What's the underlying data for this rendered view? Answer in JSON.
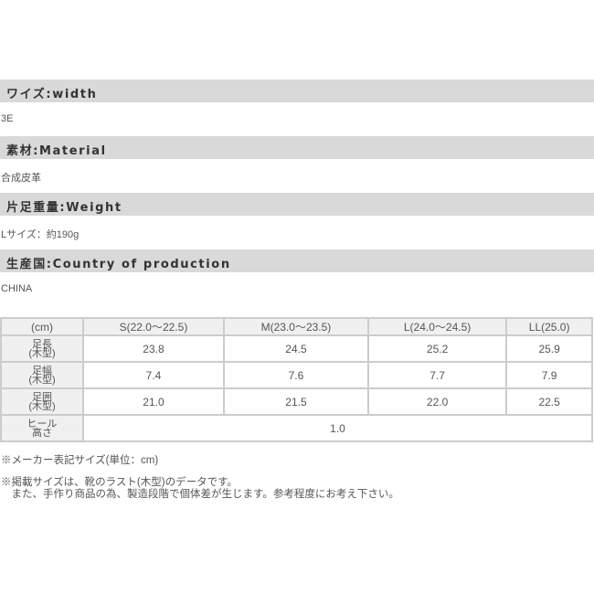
{
  "sections": [
    {
      "heading": "ワイズ:width",
      "value": "3E"
    },
    {
      "heading": "素材:Material",
      "value": "合成皮革"
    },
    {
      "heading": "片足重量:Weight",
      "value": "Lサイズ：約190g"
    },
    {
      "heading": "生産国:Country of production",
      "value": "CHINA"
    }
  ],
  "size_table": {
    "corner": "(cm)",
    "columns": [
      "S(22.0〜22.5)",
      "M(23.0〜23.5)",
      "L(24.0〜24.5)",
      "LL(25.0)"
    ],
    "rows": [
      {
        "label_line1": "足長",
        "label_line2": "(木型)",
        "values": [
          "23.8",
          "24.5",
          "25.2",
          "25.9"
        ]
      },
      {
        "label_line1": "足幅",
        "label_line2": "(木型)",
        "values": [
          "7.4",
          "7.6",
          "7.7",
          "7.9"
        ]
      },
      {
        "label_line1": "足囲",
        "label_line2": "(木型)",
        "values": [
          "21.0",
          "21.5",
          "22.0",
          "22.5"
        ]
      }
    ],
    "heel": {
      "label_line1": "ヒール",
      "label_line2": "高さ",
      "value": "1.0"
    }
  },
  "notes": {
    "unit": "※メーカー表記サイズ(単位：cm)",
    "disclaimer_line1": "※掲載サイズは、靴のラスト(木型)のデータです。",
    "disclaimer_line2": "　また、手作り商品の為、製造段階で個体差が生じます。参考程度にお考え下さい。"
  }
}
